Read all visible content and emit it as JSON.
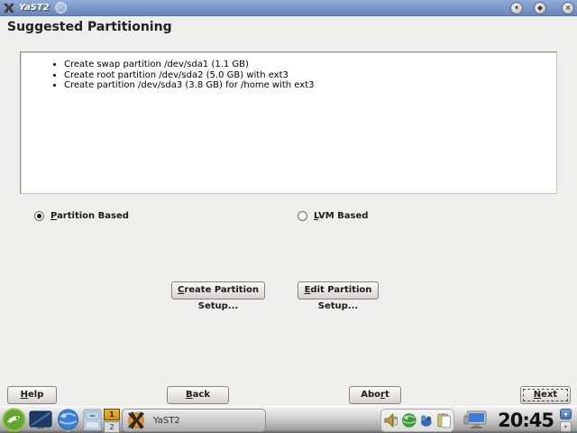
{
  "window": {
    "title": "YaST2",
    "icons": {
      "minimize": "▾",
      "maximize": "◆",
      "close": "×",
      "lock": "•"
    }
  },
  "heading": "Suggested Partitioning",
  "proposal": {
    "items": [
      "Create swap partition /dev/sda1 (1.1 GB)",
      "Create root partition /dev/sda2 (5.0 GB) with ext3",
      "Create partition /dev/sda3 (3.8 GB) for /home with ext3"
    ]
  },
  "options": {
    "partition_based": {
      "key": "P",
      "post": "artition Based",
      "selected": "true"
    },
    "lvm_based": {
      "key": "L",
      "post": "VM Based",
      "selected": "false"
    }
  },
  "actions": {
    "create": {
      "key": "C",
      "post": "reate Partition Setup..."
    },
    "edit": {
      "key": "E",
      "post": "dit Partition Setup..."
    }
  },
  "nav": {
    "help": {
      "pre": "",
      "key": "H",
      "post": "elp"
    },
    "back": {
      "pre": "",
      "key": "B",
      "post": "ack"
    },
    "abort": {
      "pre": "Abo",
      "key": "r",
      "post": "t"
    },
    "next": {
      "pre": "",
      "key": "N",
      "post": "ext"
    }
  },
  "taskbar": {
    "pager": {
      "desktop1": "1",
      "desktop2": "2"
    },
    "task_yast": "YaST2",
    "clock": "20:45"
  },
  "colors": {
    "titlebar_blue": "#7b97c8",
    "desktop1_active": "#e0a410",
    "panel_bg": "#ffffff",
    "client_bg": "#eeeeec"
  }
}
